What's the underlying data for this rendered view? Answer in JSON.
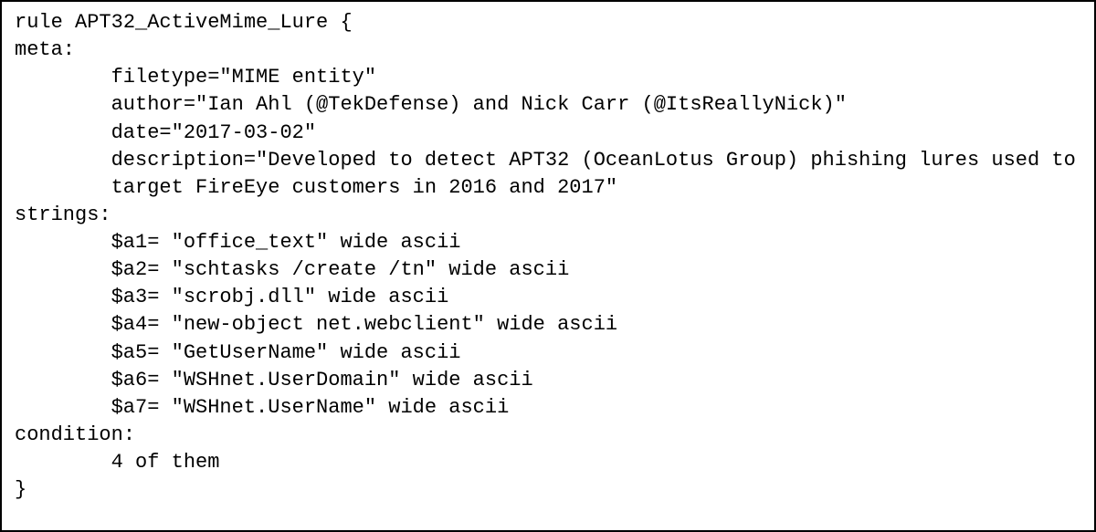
{
  "code": {
    "rule_header": "rule APT32_ActiveMime_Lure {",
    "meta_label": "meta:",
    "meta_filetype": "filetype=\"MIME entity\"",
    "meta_author": "author=\"Ian Ahl (@TekDefense) and Nick Carr (@ItsReallyNick)\"",
    "meta_date": "date=\"2017-03-02\"",
    "meta_description": "description=\"Developed to detect APT32 (OceanLotus Group) phishing lures used to target FireEye customers in 2016 and 2017\"",
    "strings_label": "strings:",
    "s_a1": "$a1= \"office_text\" wide ascii",
    "s_a2": "$a2= \"schtasks /create /tn\" wide ascii",
    "s_a3": "$a3= \"scrobj.dll\" wide ascii",
    "s_a4": "$a4= \"new-object net.webclient\" wide ascii",
    "s_a5": "$a5= \"GetUserName\" wide ascii",
    "s_a6": "$a6= \"WSHnet.UserDomain\" wide ascii",
    "s_a7": "$a7= \"WSHnet.UserName\" wide ascii",
    "condition_label": "condition:",
    "condition_body": "4 of them",
    "closing": "}"
  }
}
